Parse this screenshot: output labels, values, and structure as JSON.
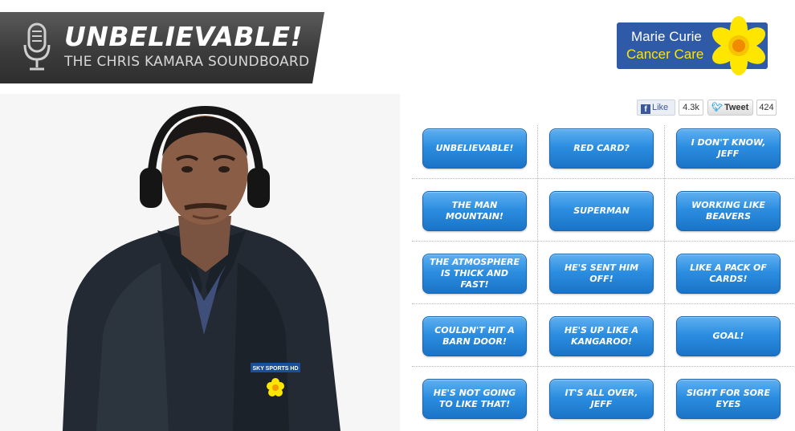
{
  "header": {
    "title": "UNBELIEVABLE!",
    "subtitle": "THE CHRIS KAMARA SOUNDBOARD",
    "icon": "microphone-icon"
  },
  "sponsor": {
    "line1": "Marie Curie",
    "line2": "Cancer Care",
    "icon": "daffodil-icon",
    "colors": {
      "background": "#2f5aa8",
      "accent": "#ffe600"
    }
  },
  "social": {
    "facebook": {
      "label": "Like",
      "count": "4.3k"
    },
    "twitter": {
      "label": "Tweet",
      "count": "424"
    }
  },
  "soundboard": {
    "button_color": "#2c8ee1",
    "buttons": [
      "UNBELIEVABLE!",
      "RED CARD?",
      "I DON'T KNOW, JEFF",
      "THE MAN MOUNTAIN!",
      "SUPERMAN",
      "WORKING LIKE BEAVERS",
      "THE ATMOSPHERE IS THICK AND FAST!",
      "HE'S SENT HIM OFF!",
      "LIKE A PACK OF CARDS!",
      "COULDN'T HIT A BARN DOOR!",
      "HE'S UP LIKE A KANGAROO!",
      "GOAL!",
      "HE'S NOT GOING TO LIKE THAT!",
      "IT'S ALL OVER, JEFF",
      "SIGHT FOR SORE EYES"
    ]
  },
  "photo": {
    "jacket_badge": "SKY SPORTS HD"
  }
}
